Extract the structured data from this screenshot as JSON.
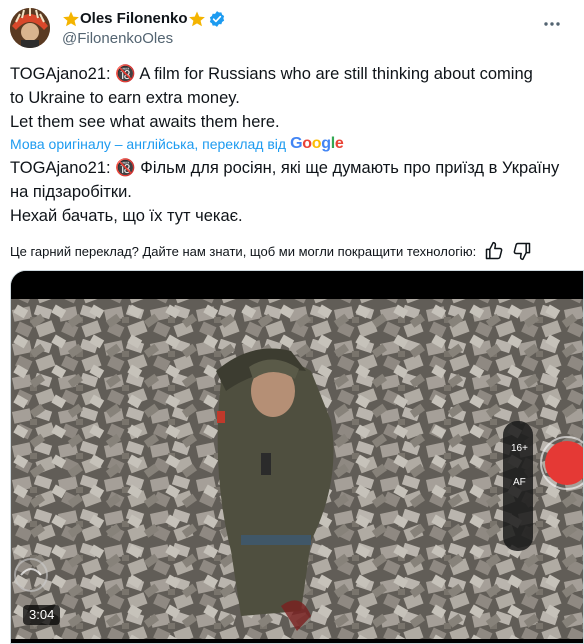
{
  "author": {
    "display_name": "Oles Filonenko",
    "handle": "@FilonenkoOles",
    "icons": [
      "star-icon",
      "star-icon",
      "verified-badge-icon"
    ]
  },
  "tweet": {
    "lines": [
      "TOGAjano21: 🔞 A film for Russians who are still thinking about coming",
      "to Ukraine to earn extra money.",
      "Let them see what awaits them here."
    ]
  },
  "translation": {
    "label": "Мова оригіналу – англійська, переклад від",
    "provider": "Google",
    "lines": [
      "TOGAjano21: 🔞 Фільм для росіян, які ще думають про приїзд в Україну",
      "на підзаробітки.",
      "Нехай бачать, що їх тут чекає."
    ]
  },
  "feedback": {
    "question": "Це гарний переклад? Дайте нам знати, щоб ми могли покращити технологію:"
  },
  "media": {
    "duration": "3:04"
  },
  "colors": {
    "accent": "#1d9bf0",
    "text": "#0f1419",
    "secondary": "#536471",
    "star": "#f4b400"
  }
}
